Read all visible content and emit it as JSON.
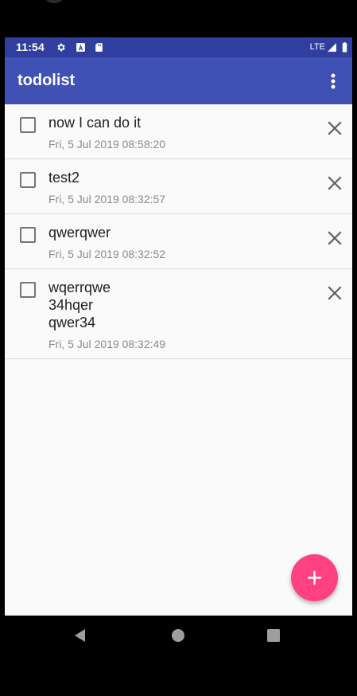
{
  "status_bar": {
    "time": "11:54",
    "network": "LTE",
    "icons": [
      "settings-icon",
      "a-notification-icon",
      "sd-card-icon",
      "signal-icon",
      "battery-icon"
    ]
  },
  "app_bar": {
    "title": "todolist",
    "menu_icon": "more-vert-icon"
  },
  "todos": [
    {
      "title": "now I can do it",
      "date": "Fri, 5 Jul 2019 08:58:20",
      "checked": false
    },
    {
      "title": "test2",
      "date": "Fri, 5 Jul 2019 08:32:57",
      "checked": false
    },
    {
      "title": "qwerqwer",
      "date": "Fri, 5 Jul 2019 08:32:52",
      "checked": false
    },
    {
      "title": "wqerrqwe\n34hqer\nqwer34",
      "date": "Fri, 5 Jul 2019 08:32:49",
      "checked": false
    }
  ],
  "fab": {
    "icon": "plus-icon"
  },
  "nav_bar": {
    "icons": [
      "back-icon",
      "home-icon",
      "recents-icon"
    ]
  },
  "colors": {
    "status_bar": "#303f9f",
    "app_bar": "#3f51b5",
    "fab": "#ff4081",
    "background": "#fafafa"
  }
}
